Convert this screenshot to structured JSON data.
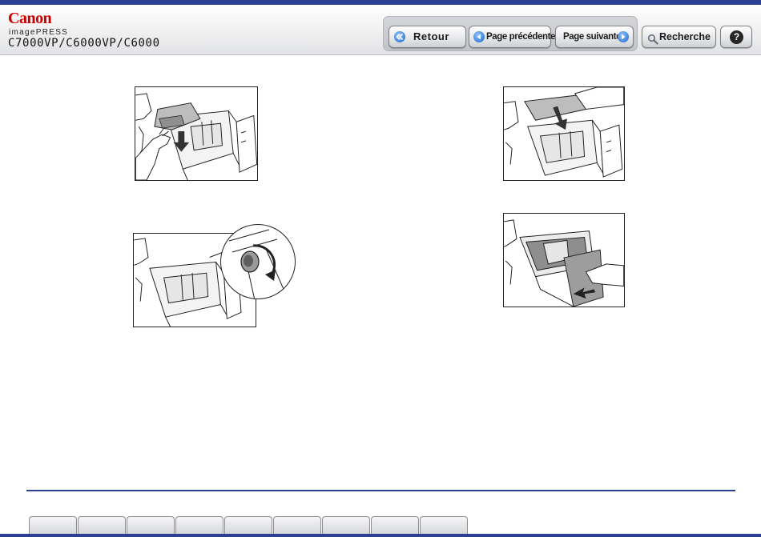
{
  "header": {
    "brand": "Canon",
    "product_line": "imagePRESS",
    "models": "C7000VP/C6000VP/C6000"
  },
  "nav": {
    "back_label": "Retour",
    "prev_label": "Page précédente",
    "next_label": "Page suivante",
    "search_label": "Recherche",
    "help_label": "?"
  },
  "colors": {
    "brand_red": "#cc0000",
    "accent_blue": "#2b3f94",
    "button_icon_blue": "#1a63c9"
  },
  "illustrations": [
    {
      "name": "remove-jammed-paper-step"
    },
    {
      "name": "lower-paper-into-drawer-step"
    },
    {
      "name": "turn-knob-step"
    },
    {
      "name": "push-drawer-closed-step"
    }
  ],
  "footer": {
    "tab_count": 9
  }
}
